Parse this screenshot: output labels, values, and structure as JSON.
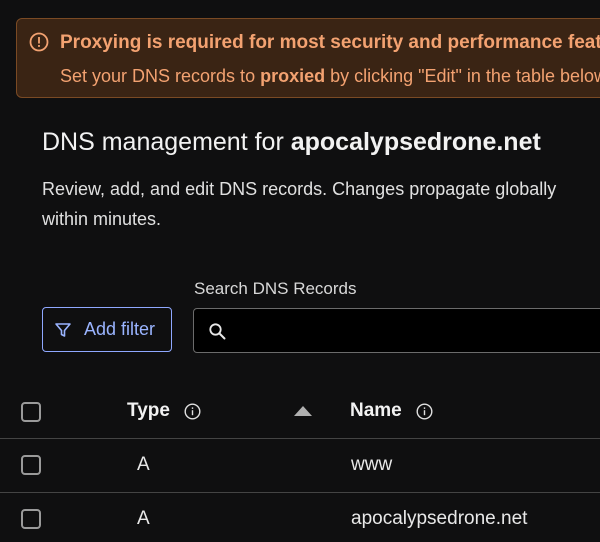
{
  "banner": {
    "title": "Proxying is required for most security and performance features",
    "body_prefix": "Set your DNS records to ",
    "body_bold": "proxied",
    "body_suffix": " by clicking \"Edit\" in the table below",
    "color": "#f3a271"
  },
  "header": {
    "title_prefix": "DNS management for ",
    "domain": "apocalypsedrone.net",
    "description_line1": "Review, add, and edit DNS records. Changes propagate globally",
    "description_line2": "within minutes."
  },
  "toolbar": {
    "add_filter_label": "Add filter",
    "search_label": "Search DNS Records",
    "search_value": "",
    "accent": "#9ab4ff"
  },
  "table": {
    "columns": {
      "type": "Type",
      "name": "Name"
    },
    "rows": [
      {
        "type": "A",
        "name": "www"
      },
      {
        "type": "A",
        "name": "apocalypsedrone.net"
      }
    ]
  }
}
